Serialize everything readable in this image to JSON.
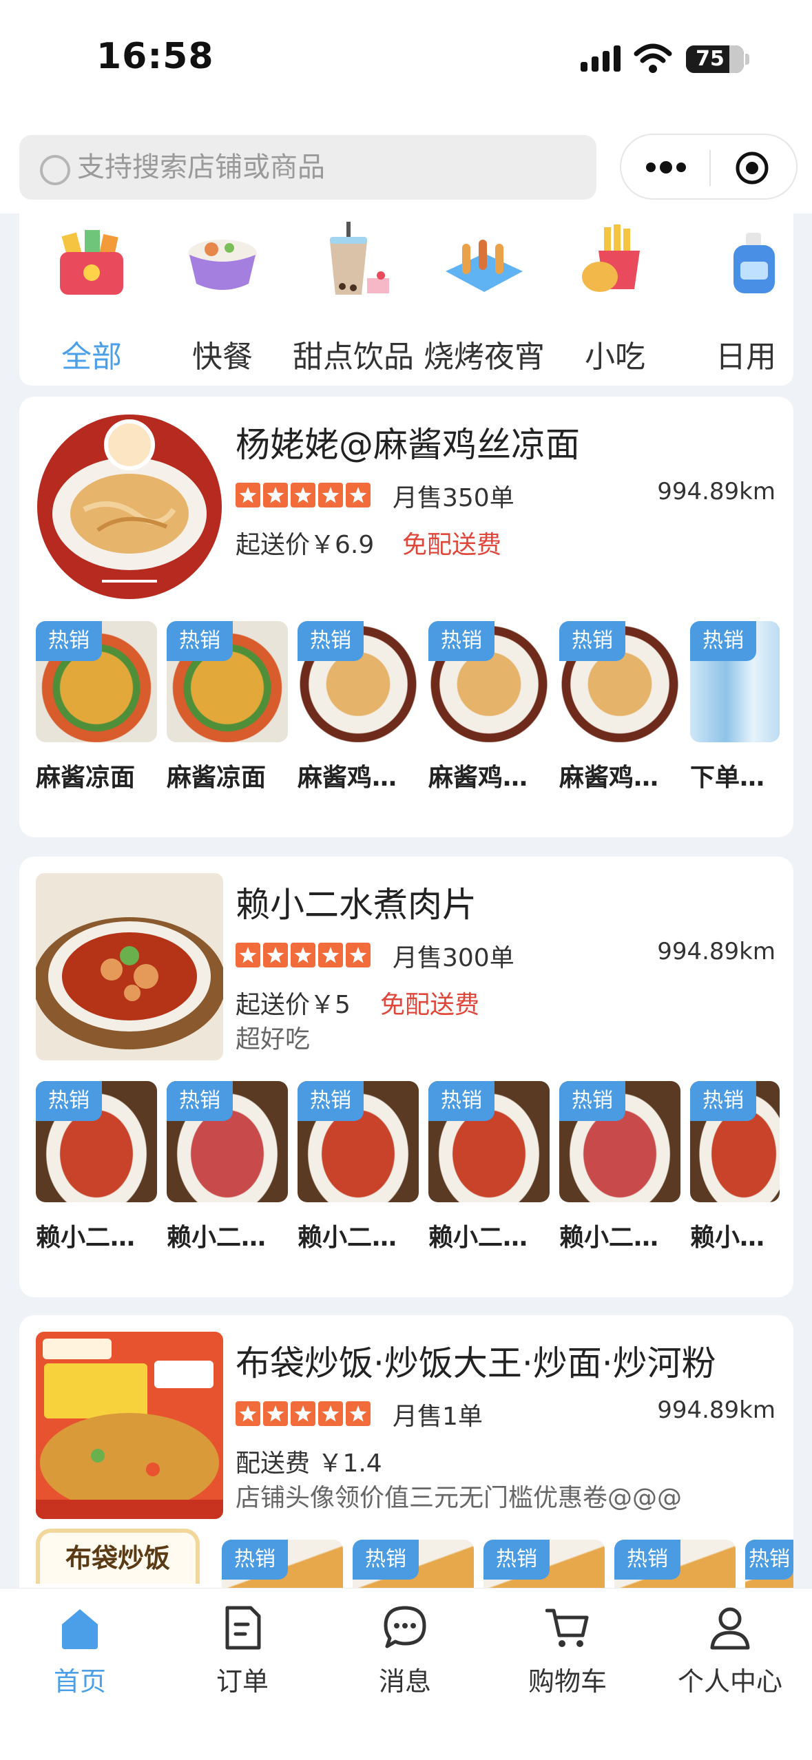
{
  "status_bar": {
    "time": "16:58",
    "battery": "75",
    "battery_level": 0.75
  },
  "search": {
    "placeholder": "支持搜索店铺或商品"
  },
  "categories": [
    {
      "label": "全部",
      "active": true,
      "icon": "gift-box-icon"
    },
    {
      "label": "快餐",
      "active": false,
      "icon": "rice-bowl-icon"
    },
    {
      "label": "甜点饮品",
      "active": false,
      "icon": "bubble-tea-icon"
    },
    {
      "label": "烧烤夜宵",
      "active": false,
      "icon": "skewer-icon"
    },
    {
      "label": "小吃",
      "active": false,
      "icon": "fries-icon"
    },
    {
      "label": "日用",
      "active": false,
      "icon": "bottle-icon"
    }
  ],
  "stores": [
    {
      "name": "杨姥姥@麻酱鸡丝凉面",
      "rating": 5,
      "monthly_sales": "月售350单",
      "distance": "994.89km",
      "fee": "起送价￥6.9",
      "promo": "免配送费",
      "slogan": "",
      "products": [
        {
          "tag": "热销",
          "name": "麻酱凉面"
        },
        {
          "tag": "热销",
          "name": "麻酱凉面"
        },
        {
          "tag": "热销",
          "name": "麻酱鸡丝凉面"
        },
        {
          "tag": "热销",
          "name": "麻酱鸡丝凉面"
        },
        {
          "tag": "热销",
          "name": "麻酱鸡丝凉面"
        },
        {
          "tag": "热销",
          "name": "下单送水"
        }
      ]
    },
    {
      "name": "赖小二水煮肉片",
      "rating": 5,
      "monthly_sales": "月售300单",
      "distance": "994.89km",
      "fee": "起送价￥5",
      "promo": "免配送费",
      "slogan": "超好吃",
      "products": [
        {
          "tag": "热销",
          "name": "赖小二水煮肉片"
        },
        {
          "tag": "热销",
          "name": "赖小二水煮肉片"
        },
        {
          "tag": "热销",
          "name": "赖小二水煮肉片"
        },
        {
          "tag": "热销",
          "name": "赖小二水煮肉片"
        },
        {
          "tag": "热销",
          "name": "赖小二水煮肉片"
        },
        {
          "tag": "热销",
          "name": "赖小二水煮肉片"
        }
      ]
    },
    {
      "name": "布袋炒饭·炒饭大王·炒面·炒河粉",
      "rating": 5,
      "monthly_sales": "月售1单",
      "distance": "994.89km",
      "fee": "配送费 ￥1.4",
      "promo": "",
      "slogan": "店铺头像领价值三元无门槛优惠卷@@@",
      "badge": "布袋炒饭",
      "products": [
        {
          "tag": "热销",
          "name": ""
        },
        {
          "tag": "热销",
          "name": ""
        },
        {
          "tag": "热销",
          "name": ""
        },
        {
          "tag": "热销",
          "name": ""
        },
        {
          "tag": "热销",
          "name": ""
        }
      ]
    }
  ],
  "tabbar": [
    {
      "label": "首页",
      "active": true,
      "icon": "home-icon"
    },
    {
      "label": "订单",
      "active": false,
      "icon": "order-icon"
    },
    {
      "label": "消息",
      "active": false,
      "icon": "message-icon"
    },
    {
      "label": "购物车",
      "active": false,
      "icon": "cart-icon"
    },
    {
      "label": "个人中心",
      "active": false,
      "icon": "user-icon"
    }
  ],
  "colors": {
    "accent": "#4a9fe8",
    "promo": "#e0463a",
    "star": "#f26b3a",
    "tag": "#4a9be2"
  }
}
